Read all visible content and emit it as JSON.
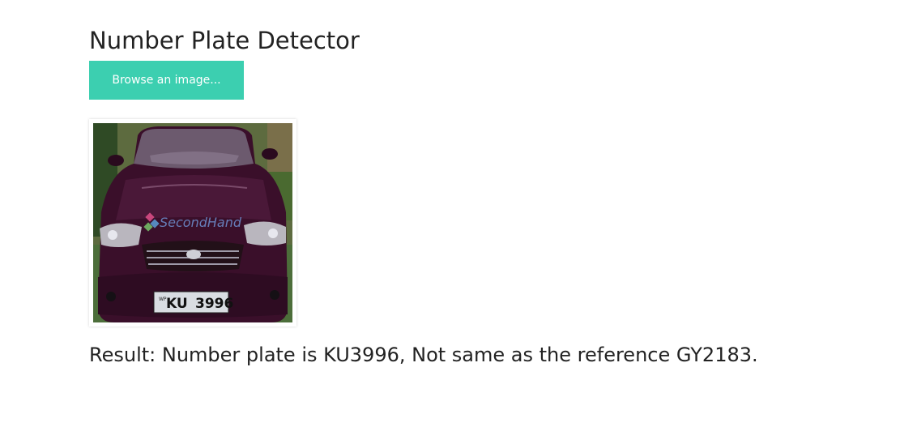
{
  "header": {
    "title": "Number Plate Detector"
  },
  "upload": {
    "browse_label": "Browse an image..."
  },
  "preview": {
    "image_name": "car-photo-thumbnail",
    "watermark_text": "SecondHand",
    "plate_prefix_text": "KU",
    "plate_number_text": "3996",
    "plate_region_text": "WP"
  },
  "result": {
    "text": "Result: Number plate is KU3996, Not same as the reference GY2183."
  },
  "colors": {
    "accent": "#3ccfb0",
    "car_body": "#3a0f2a",
    "text": "#222222"
  }
}
